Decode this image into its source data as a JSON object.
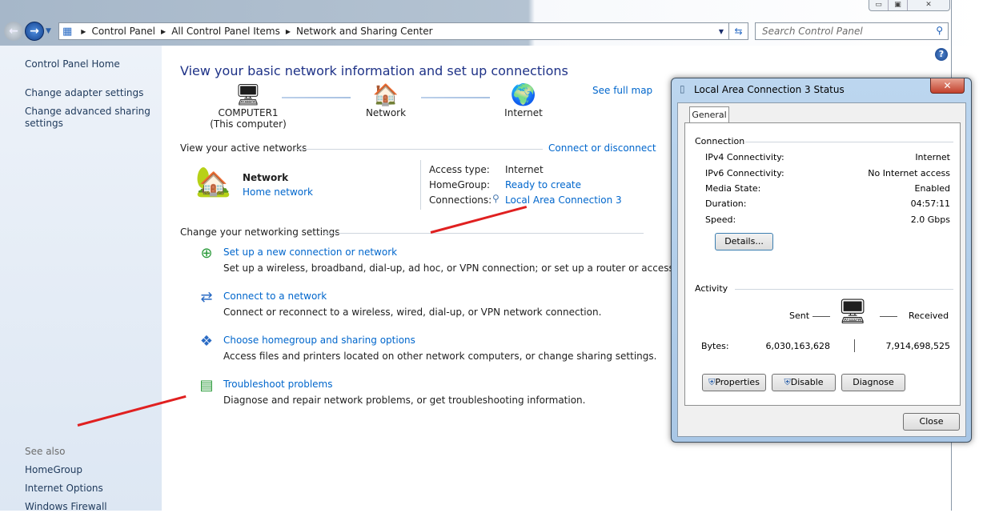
{
  "window": {
    "caption_buttons": [
      "minimize",
      "maximize",
      "close"
    ]
  },
  "address": {
    "crumbs": [
      "Control Panel",
      "All Control Panel Items",
      "Network and Sharing Center"
    ]
  },
  "search": {
    "placeholder": "Search Control Panel"
  },
  "sidebar": {
    "items": [
      "Control Panel Home",
      "Change adapter settings",
      "Change advanced sharing settings"
    ],
    "see_also_label": "See also",
    "see_also": [
      "HomeGroup",
      "Internet Options",
      "Windows Firewall"
    ]
  },
  "main": {
    "title": "View your basic network information and set up connections",
    "see_full_map": "See full map",
    "map": [
      {
        "label": "COMPUTER1",
        "sub": "(This computer)"
      },
      {
        "label": "Network"
      },
      {
        "label": "Internet"
      }
    ],
    "active_label": "View your active networks",
    "connect_disconnect": "Connect or disconnect",
    "network": {
      "name": "Network",
      "type": "Home network",
      "access_label": "Access type:",
      "access": "Internet",
      "homegroup_label": "HomeGroup:",
      "homegroup": "Ready to create",
      "connections_label": "Connections:",
      "connection": "Local Area Connection 3"
    },
    "settings_label": "Change your networking settings",
    "tasks": [
      {
        "title": "Set up a new connection or network",
        "desc": "Set up a wireless, broadband, dial-up, ad hoc, or VPN connection; or set up a router or access point."
      },
      {
        "title": "Connect to a network",
        "desc": "Connect or reconnect to a wireless, wired, dial-up, or VPN network connection."
      },
      {
        "title": "Choose homegroup and sharing options",
        "desc": "Access files and printers located on other network computers, or change sharing settings."
      },
      {
        "title": "Troubleshoot problems",
        "desc": "Diagnose and repair network problems, or get troubleshooting information."
      }
    ]
  },
  "dialog": {
    "title": "Local Area Connection 3 Status",
    "tab": "General",
    "connection_label": "Connection",
    "rows": [
      {
        "k": "IPv4 Connectivity:",
        "v": "Internet"
      },
      {
        "k": "IPv6 Connectivity:",
        "v": "No Internet access"
      },
      {
        "k": "Media State:",
        "v": "Enabled"
      },
      {
        "k": "Duration:",
        "v": "04:57:11"
      },
      {
        "k": "Speed:",
        "v": "2.0 Gbps"
      }
    ],
    "details": "Details...",
    "activity_label": "Activity",
    "sent_label": "Sent",
    "received_label": "Received",
    "bytes_label": "Bytes:",
    "bytes_sent": "6,030,163,628",
    "bytes_received": "7,914,698,525",
    "properties": "Properties",
    "disable": "Disable",
    "diagnose": "Diagnose",
    "close": "Close"
  },
  "colors": {
    "link": "#0066cc",
    "title": "#1e3287",
    "annotation_arrow": "#e02020"
  }
}
